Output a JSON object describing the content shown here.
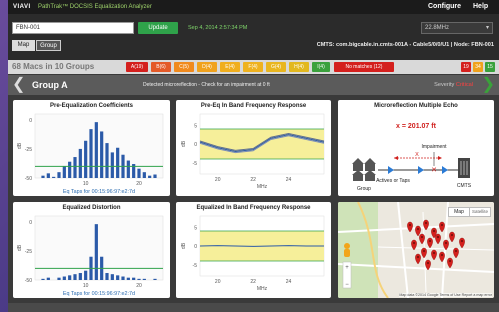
{
  "topbar": {
    "brand": "VIAVI",
    "product": "PathTrak™ DOCSIS Equalization Analyzer",
    "configure": "Configure",
    "help": "Help"
  },
  "controls": {
    "node_input": "FBN-001",
    "update_label": "Update",
    "timestamp": "Sep 4, 2014 2:57:34 PM",
    "frequency_select": "22.8MHz",
    "map_tab": "Map",
    "group_tab": "Group",
    "cmts_info": "CMTS: com.bigcable.in.cmts-001A - Cable5/0/0/U1 | Node: FBN-001"
  },
  "summary": {
    "count_label": "68 Macs in 10 Groups",
    "chips": [
      {
        "label": "A(19)",
        "color": "#d4201d"
      },
      {
        "label": "B(6)",
        "color": "#e45a28"
      },
      {
        "label": "C(5)",
        "color": "#f08a1d"
      },
      {
        "label": "D(4)",
        "color": "#f0a21d"
      },
      {
        "label": "E(4)",
        "color": "#f0ae1d"
      },
      {
        "label": "F(4)",
        "color": "#efb21f"
      },
      {
        "label": "G(4)",
        "color": "#e9b61f"
      },
      {
        "label": "H(4)",
        "color": "#e2b81f"
      },
      {
        "label": "I(4)",
        "color": "#3aa13c"
      }
    ],
    "no_matches": "No matches (12)",
    "counters": [
      {
        "label": "19",
        "color": "#d4201d"
      },
      {
        "label": "34",
        "color": "#f0a21d"
      },
      {
        "label": "15",
        "color": "#3aa13c"
      }
    ]
  },
  "group": {
    "title": "Group A",
    "message": "Detected microreflection - Check for an impairment at 0 ft",
    "severity_label": "Severity",
    "severity_value": "Critical"
  },
  "panels": {
    "pre_eq": {
      "title": "Pre-Equalization Coefficients",
      "ylabel": "dB",
      "yticks": [
        "0",
        "-25",
        "-50"
      ],
      "xticks": [
        "10",
        "20"
      ],
      "caption": "Eq Taps for 00:15:96:97:e2:7d"
    },
    "freq": {
      "title": "Pre-Eq In Band Frequency Response",
      "ylabel": "dB",
      "yticks": [
        "5",
        "0",
        "-5"
      ],
      "xticks": [
        "20",
        "22",
        "24"
      ],
      "xlabel": "MHz"
    },
    "echo": {
      "title": "Microreflection Multiple Echo",
      "distance": "x = 201.07 ft",
      "impairment": "Impairment",
      "x_label": "X",
      "group_label": "Group",
      "actives_label": "Actives or Taps",
      "cmts_label": "CMTS"
    },
    "dist": {
      "title": "Equalized Distortion",
      "ylabel": "dB",
      "yticks": [
        "0",
        "-25",
        "-50"
      ],
      "xticks": [
        "10",
        "20"
      ],
      "caption": "Eq Taps for 00:15:96:97:e2:7d"
    },
    "eq_freq": {
      "title": "Equalized In Band Frequency Response",
      "ylabel": "dB",
      "yticks": [
        "5",
        "0",
        "-5"
      ],
      "xticks": [
        "20",
        "22",
        "24"
      ],
      "xlabel": "MHz"
    },
    "map": {
      "map_btn": "Map",
      "sat_btn": "Satellite",
      "attribution": "Map data ©2014 Google  Terms of Use  Report a map error"
    }
  },
  "chart_data": [
    {
      "type": "bar",
      "title": "Pre-Equalization Coefficients",
      "xlabel": "Eq Taps for 00:15:96:97:e2:7d",
      "ylabel": "dB",
      "ylim": [
        -50,
        5
      ],
      "x": [
        1,
        2,
        3,
        4,
        5,
        6,
        7,
        8,
        9,
        10,
        11,
        12,
        13,
        14,
        15,
        16,
        17,
        18,
        19,
        20,
        21,
        22,
        23,
        24
      ],
      "values": [
        -50,
        -48,
        -46,
        -49,
        -45,
        -40,
        -36,
        -32,
        -25,
        -18,
        -8,
        -2,
        -10,
        -20,
        -28,
        -24,
        -30,
        -35,
        -38,
        -42,
        -45,
        -48,
        -47,
        -50
      ]
    },
    {
      "type": "line",
      "title": "Pre-Eq In Band Frequency Response",
      "xlabel": "MHz",
      "ylabel": "dB",
      "xlim": [
        19,
        26
      ],
      "ylim": [
        -8,
        8
      ],
      "x": [
        19,
        20,
        21,
        22,
        23,
        24,
        25,
        26
      ],
      "series": [
        {
          "values": [
            0.5,
            -1,
            -2,
            -1.5,
            1.5,
            2.5,
            1.5,
            0.5
          ]
        },
        {
          "values": [
            0.2,
            -1.3,
            -2.3,
            -1.8,
            1.2,
            2.2,
            1.2,
            0.2
          ]
        },
        {
          "values": [
            0.8,
            -0.7,
            -1.7,
            -1.2,
            1.8,
            2.8,
            1.8,
            0.8
          ]
        }
      ]
    },
    {
      "type": "bar",
      "title": "Equalized Distortion",
      "xlabel": "Eq Taps for 00:15:96:97:e2:7d",
      "ylabel": "dB",
      "ylim": [
        -50,
        5
      ],
      "x": [
        1,
        2,
        3,
        4,
        5,
        6,
        7,
        8,
        9,
        10,
        11,
        12,
        13,
        14,
        15,
        16,
        17,
        18,
        19,
        20,
        21,
        22,
        23,
        24
      ],
      "values": [
        -50,
        -49,
        -48,
        -50,
        -48,
        -47,
        -46,
        -45,
        -44,
        -42,
        -30,
        -2,
        -30,
        -44,
        -45,
        -46,
        -47,
        -48,
        -48,
        -49,
        -49,
        -50,
        -49,
        -50
      ]
    },
    {
      "type": "line",
      "title": "Equalized In Band Frequency Response",
      "xlabel": "MHz",
      "ylabel": "dB",
      "xlim": [
        19,
        26
      ],
      "ylim": [
        -8,
        8
      ],
      "x": [
        19,
        20,
        21,
        22,
        23,
        24,
        25,
        26
      ],
      "series": [
        {
          "values": [
            0,
            0.1,
            0,
            -0.1,
            0,
            0.1,
            0,
            0
          ]
        }
      ]
    }
  ]
}
